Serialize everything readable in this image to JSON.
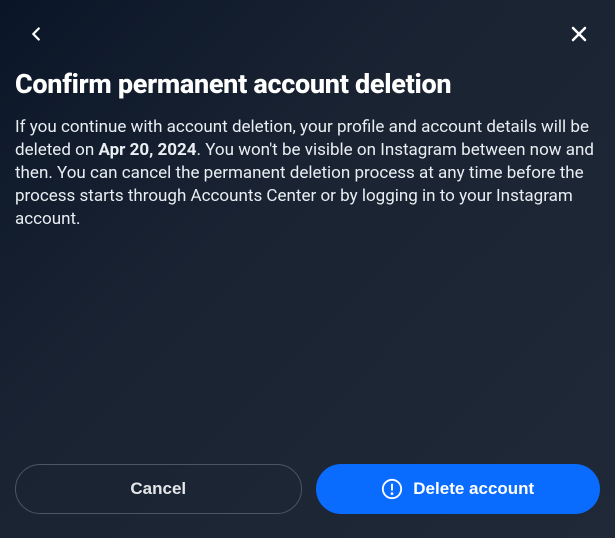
{
  "header": {
    "title": "Confirm permanent account deletion"
  },
  "description": {
    "part1": "If you continue with account deletion, your profile and account details will be deleted on ",
    "date": "Apr 20, 2024",
    "part2": ". You won't be visible on Instagram between now and then. You can cancel the permanent deletion process at any time before the process starts through Accounts Center or by logging in to your Instagram account."
  },
  "actions": {
    "cancel_label": "Cancel",
    "delete_label": "Delete account"
  }
}
